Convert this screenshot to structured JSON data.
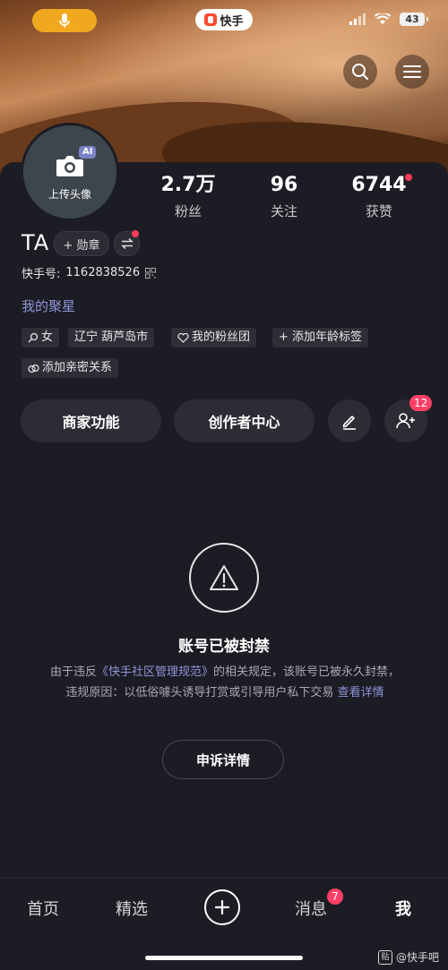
{
  "status_bar": {
    "app_name": "快手",
    "battery": "43",
    "icons": [
      "mic-icon",
      "signal-icon",
      "wifi-icon",
      "battery-icon"
    ]
  },
  "header": {
    "icons": [
      "search-icon",
      "menu-icon"
    ]
  },
  "profile": {
    "avatar_badge": "AI",
    "avatar_label": "上传头像",
    "name": "TA",
    "medal_label": "+ 勋章",
    "kwai_id_label": "快手号:",
    "kwai_id": "1162838526",
    "juxing": "我的聚星",
    "stats": [
      {
        "value": "2.7万",
        "label": "粉丝"
      },
      {
        "value": "96",
        "label": "关注"
      },
      {
        "value": "6744",
        "label": "获赞"
      }
    ],
    "tags": [
      "女",
      "辽宁 葫芦岛市",
      "我的粉丝团",
      "+ 添加年龄标签",
      "添加亲密关系"
    ]
  },
  "actions": {
    "merchant": "商家功能",
    "creator": "创作者中心",
    "friends_badge": "12"
  },
  "ban": {
    "title": "账号已被封禁",
    "desc_1": "由于违反",
    "desc_link": "《快手社区管理规范》",
    "desc_2": "的相关规定，该账号已被永久封禁，违规原因：以低俗噱头诱导打赏或引导用户私下交易",
    "desc_detail": "查看详情",
    "appeal": "申诉详情"
  },
  "tabbar": {
    "home": "首页",
    "featured": "精选",
    "messages": "消息",
    "messages_badge": "7",
    "me": "我"
  },
  "watermark": {
    "icon_text": "贴",
    "text": "@快手吧"
  },
  "colors": {
    "background": "#1c1c24",
    "accent_link": "#8e94d8",
    "badge_red": "#ff4066",
    "mic_pill": "#f0a81f"
  }
}
